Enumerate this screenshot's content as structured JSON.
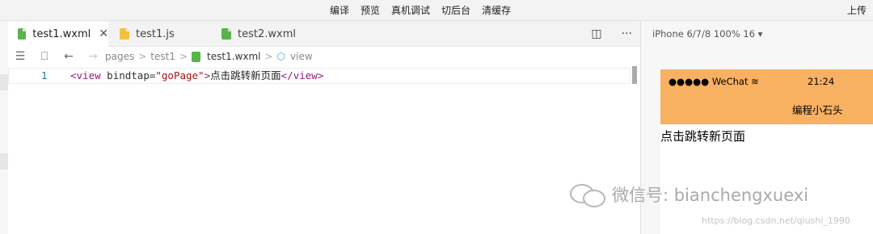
{
  "menu": [
    "编译",
    "预览",
    "真机调试",
    "切后台",
    "清缓存"
  ],
  "upload": "上传",
  "tabs": [
    {
      "label": "test1.wxml",
      "icon": "wxml-file-icon",
      "close": "✕"
    },
    {
      "label": "test1.js",
      "icon": "js-file-icon"
    },
    {
      "label": "test2.wxml",
      "icon": "wxml-file-icon"
    }
  ],
  "tab_tools": {
    "split": "◫",
    "more": "···"
  },
  "breadcrumb": {
    "items": [
      "pages",
      "test1",
      "test1.wxml",
      "view"
    ],
    "separator": ">"
  },
  "code": {
    "line_number": "1",
    "open_tag": "<view",
    "attr": " bindtap=",
    "attr_value": "\"goPage\"",
    "close_open": ">",
    "text": "点击跳转新页面",
    "end_tag": "</view>"
  },
  "device": {
    "label": "iPhone 6/7/8 100% 16 ▾"
  },
  "phone": {
    "signal": "●●●●● WeChat",
    "time": "21:24",
    "title": "编程小石头",
    "page_text": "点击跳转新页面"
  },
  "watermark": "微信号: bianchengxuexi",
  "source_watermark": "https://blog.csdn.net/qiushi_1990",
  "colors": {
    "navbar": "#f8b061",
    "wxml_icon": "#58b44a",
    "js_icon": "#f3c13b"
  }
}
